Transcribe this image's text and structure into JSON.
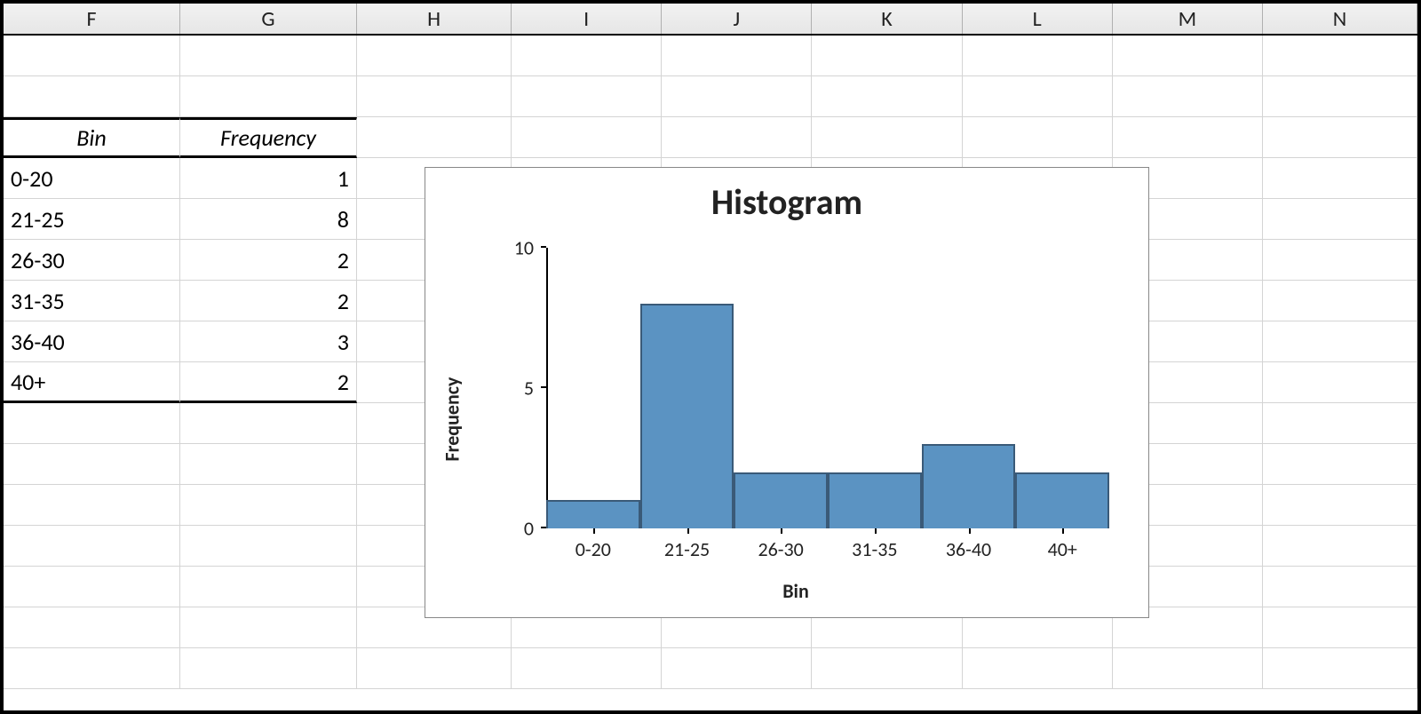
{
  "columns": [
    "F",
    "G",
    "H",
    "I",
    "J",
    "K",
    "L",
    "M",
    "N"
  ],
  "table": {
    "headers": {
      "bin": "Bin",
      "freq": "Frequency"
    },
    "rows": [
      {
        "bin": "0-20",
        "freq": "1"
      },
      {
        "bin": "21-25",
        "freq": "8"
      },
      {
        "bin": "26-30",
        "freq": "2"
      },
      {
        "bin": "31-35",
        "freq": "2"
      },
      {
        "bin": "36-40",
        "freq": "3"
      },
      {
        "bin": "40+",
        "freq": "2"
      }
    ]
  },
  "chart": {
    "title": "Histogram",
    "xlabel": "Bin",
    "ylabel": "Frequency",
    "yticks": [
      "0",
      "5",
      "10"
    ]
  },
  "chart_data": {
    "type": "bar",
    "title": "Histogram",
    "xlabel": "Bin",
    "ylabel": "Frequency",
    "ylim": [
      0,
      10
    ],
    "categories": [
      "0-20",
      "21-25",
      "26-30",
      "31-35",
      "36-40",
      "40+"
    ],
    "values": [
      1,
      8,
      2,
      2,
      3,
      2
    ]
  }
}
